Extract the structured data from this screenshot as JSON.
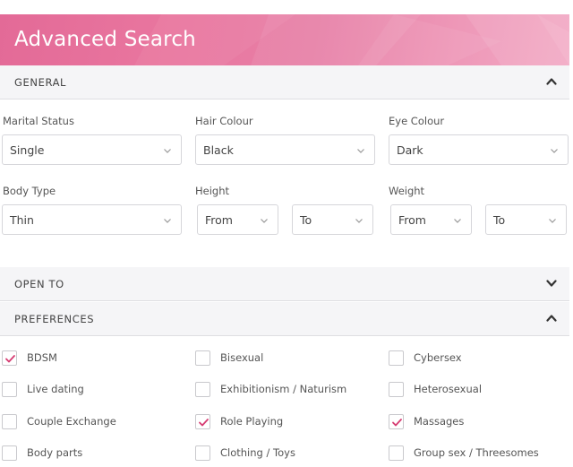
{
  "header": {
    "title": "Advanced Search"
  },
  "sections": {
    "general": {
      "label": "GENERAL",
      "state": "expanded"
    },
    "open_to": {
      "label": "OPEN TO",
      "state": "collapsed"
    },
    "preferences": {
      "label": "PREFERENCES",
      "state": "expanded"
    }
  },
  "general": {
    "marital_status": {
      "label": "Marital Status",
      "value": "Single"
    },
    "hair_colour": {
      "label": "Hair Colour",
      "value": "Black"
    },
    "eye_colour": {
      "label": "Eye Colour",
      "value": "Dark"
    },
    "body_type": {
      "label": "Body Type",
      "value": "Thin"
    },
    "height": {
      "label": "Height",
      "from": "From",
      "to": "To"
    },
    "weight": {
      "label": "Weight",
      "from": "From",
      "to": "To"
    }
  },
  "preferences": [
    {
      "label": "BDSM",
      "checked": true
    },
    {
      "label": "Bisexual",
      "checked": false
    },
    {
      "label": "Cybersex",
      "checked": false
    },
    {
      "label": "Live dating",
      "checked": false
    },
    {
      "label": "Exhibitionism / Naturism",
      "checked": false
    },
    {
      "label": "Heterosexual",
      "checked": false
    },
    {
      "label": "Couple Exchange",
      "checked": false
    },
    {
      "label": "Role Playing",
      "checked": true
    },
    {
      "label": "Massages",
      "checked": true
    },
    {
      "label": "Body parts",
      "checked": false
    },
    {
      "label": "Clothing / Toys",
      "checked": false
    },
    {
      "label": "Group sex / Threesomes",
      "checked": false
    }
  ],
  "colors": {
    "accent": "#e36a97",
    "check": "#d63c72",
    "bar_bg": "#f5f5f7"
  },
  "icons": {
    "expanded": "chevron-up-icon",
    "collapsed": "chevron-down-icon",
    "select": "chevron-down-icon",
    "check": "check-icon"
  }
}
